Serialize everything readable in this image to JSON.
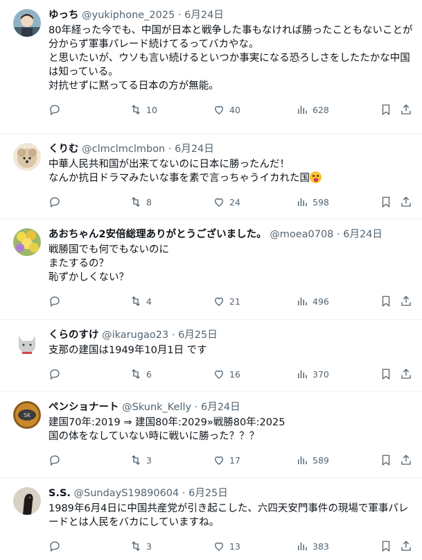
{
  "tweets": [
    {
      "name": "ゆっち",
      "handle": "@yukiphone_2025",
      "dot": "·",
      "date": "6月24日",
      "text": "80年経った今でも、中国が日本と戦争した事もなければ勝ったこともないことが分からず軍事パレード続けてるってバカやな。\nと思いたいが、ウソも言い続けるといつか事実になる恐ろしさをしたたかな中国は知っている。\n対抗せずに黙ってる日本の方が無能。",
      "retweets": "10",
      "likes": "40",
      "views": "628",
      "avatar_color": "#7a9fb2"
    },
    {
      "name": "くりむ",
      "handle": "@clmclmclmbon",
      "dot": "·",
      "date": "6月24日",
      "text": "中華人民共和国が出来てないのに日本に勝ったんだ！\nなんか抗日ドラマみたいな事を素で言っちゃうイカれた国",
      "emoji": "face-with-tongue",
      "retweets": "8",
      "likes": "24",
      "views": "598",
      "avatar_color": "#d9c7a8"
    },
    {
      "name": "あおちゃん2安倍総理ありがとうございました。",
      "handle": "@moea0708",
      "dot": "·",
      "date": "6月24日",
      "text": "戦勝国でも何でもないのに\nまたするの？\n恥ずかしくない？",
      "retweets": "4",
      "likes": "21",
      "views": "496",
      "avatar_color": "#d8c24a"
    },
    {
      "name": "くらのすけ",
      "handle": "@ikarugao23",
      "dot": "·",
      "date": "6月25日",
      "text": "支那の建国は1949年10月1日 です",
      "retweets": "6",
      "likes": "16",
      "views": "370",
      "avatar_color": "#eeeeee"
    },
    {
      "name": "ペンショナート",
      "handle": "@Skunk_Kelly",
      "dot": "·",
      "date": "6月24日",
      "text": "建国70年:2019 ⇒ 建国80年:2029»戦勝80年:2025\n国の体をなしていない時に戦いに勝った？？？",
      "retweets": "3",
      "likes": "17",
      "views": "589",
      "avatar_color": "#c98a2b"
    },
    {
      "name": "S.S.",
      "handle": "@SundayS19890604",
      "dot": "·",
      "date": "6月25日",
      "text": "1989年6月4日に中国共産党が引き起こした、六四天安門事件の現場で軍事パレードとは人民をバカにしていますね。",
      "retweets": "3",
      "likes": "13",
      "views": "383",
      "avatar_color": "#2b2b2b"
    }
  ]
}
